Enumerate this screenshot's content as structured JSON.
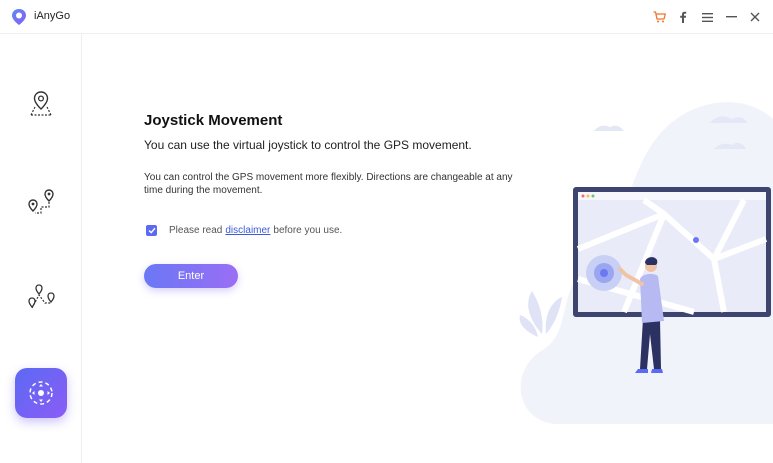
{
  "app": {
    "title": "iAnyGo",
    "brand_color": "#5b6af3",
    "accent_gradient": [
      "#6a78f5",
      "#9a6ef5"
    ]
  },
  "titlebar": {
    "controls": [
      {
        "icon": "cart-icon",
        "color": "#f0752b"
      },
      {
        "icon": "facebook-icon",
        "color": "#555555"
      },
      {
        "icon": "menu-icon",
        "color": "#555555"
      },
      {
        "icon": "minimize-icon",
        "color": "#555555"
      },
      {
        "icon": "close-icon",
        "color": "#555555"
      }
    ]
  },
  "sidebar": {
    "items": [
      {
        "icon": "teleport-pin-icon",
        "active": false
      },
      {
        "icon": "two-spot-route-icon",
        "active": false
      },
      {
        "icon": "multi-spot-route-icon",
        "active": false
      },
      {
        "icon": "joystick-icon",
        "active": true
      }
    ]
  },
  "main": {
    "heading": "Joystick Movement",
    "subheading": "You can use the virtual joystick to control the GPS movement.",
    "description": "You can control the GPS movement more flexibly. Directions are changeable at any time during the movement.",
    "agreement": {
      "checked": true,
      "prefix": "Please read",
      "link_text": "disclaimer",
      "suffix": "before you use."
    },
    "enter_label": "Enter"
  }
}
